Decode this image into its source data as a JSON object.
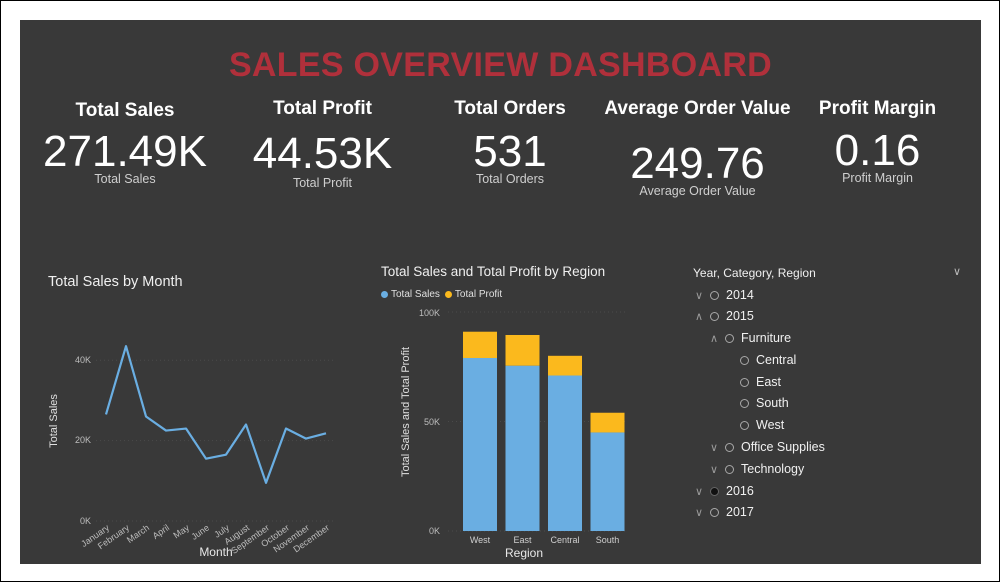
{
  "dashboard": {
    "title": "SALES OVERVIEW DASHBOARD"
  },
  "kpis": [
    {
      "heading": "Total Sales",
      "value": "271.49K",
      "sublabel": "Total Sales"
    },
    {
      "heading": "Total Profit",
      "value": "44.53K",
      "sublabel": "Total Profit"
    },
    {
      "heading": "Total Orders",
      "value": "531",
      "sublabel": "Total Orders"
    },
    {
      "heading": "Average Order Value",
      "value": "249.76",
      "sublabel": "Average Order Value"
    },
    {
      "heading": "Profit Margin",
      "value": "0.16",
      "sublabel": "Profit Margin"
    }
  ],
  "colors": {
    "title": "#b0303b",
    "sales": "#6aaee2",
    "profit": "#fbb91d",
    "background": "#393939"
  },
  "line_chart": {
    "title": "Total Sales by Month",
    "xlabel": "Month",
    "ylabel": "Total Sales",
    "yticks": [
      "0K",
      "20K",
      "40K"
    ]
  },
  "bar_chart": {
    "title": "Total Sales and Total Profit by Region",
    "xlabel": "Region",
    "ylabel": "Total Sales and Total Profit",
    "yticks": [
      "0K",
      "50K",
      "100K"
    ],
    "legend": [
      "Total Sales",
      "Total Profit"
    ]
  },
  "chart_data": [
    {
      "type": "line",
      "title": "Total Sales by Month",
      "xlabel": "Month",
      "ylabel": "Total Sales",
      "categories": [
        "January",
        "February",
        "March",
        "April",
        "May",
        "June",
        "July",
        "August",
        "September",
        "October",
        "November",
        "December"
      ],
      "values": [
        26500,
        43500,
        26000,
        22500,
        23000,
        15500,
        16500,
        24000,
        9500,
        23000,
        20500,
        21800
      ],
      "ylim": [
        0,
        50000
      ],
      "grid": true
    },
    {
      "type": "bar",
      "stacked": true,
      "title": "Total Sales and Total Profit by Region",
      "xlabel": "Region",
      "ylabel": "Total Sales and Total Profit",
      "categories": [
        "West",
        "East",
        "Central",
        "South"
      ],
      "series": [
        {
          "name": "Total Sales",
          "values": [
            79000,
            75500,
            71000,
            45000
          ]
        },
        {
          "name": "Total Profit",
          "values": [
            12000,
            14000,
            9000,
            9000
          ]
        }
      ],
      "ylim": [
        0,
        100000
      ],
      "legend": "top-left"
    }
  ],
  "slicer": {
    "header": "Year, Category, Region",
    "items": [
      {
        "label": "2014",
        "level": 0,
        "chevron": "down",
        "selected": false
      },
      {
        "label": "2015",
        "level": 0,
        "chevron": "up",
        "selected": false
      },
      {
        "label": "Furniture",
        "level": 1,
        "chevron": "up",
        "selected": false
      },
      {
        "label": "Central",
        "level": 2,
        "chevron": "",
        "selected": false
      },
      {
        "label": "East",
        "level": 2,
        "chevron": "",
        "selected": false
      },
      {
        "label": "South",
        "level": 2,
        "chevron": "",
        "selected": false
      },
      {
        "label": "West",
        "level": 2,
        "chevron": "",
        "selected": false
      },
      {
        "label": "Office Supplies",
        "level": 1,
        "chevron": "down",
        "selected": false
      },
      {
        "label": "Technology",
        "level": 1,
        "chevron": "down",
        "selected": false
      },
      {
        "label": "2016",
        "level": 0,
        "chevron": "down",
        "selected": true
      },
      {
        "label": "2017",
        "level": 0,
        "chevron": "down",
        "selected": false
      }
    ]
  }
}
